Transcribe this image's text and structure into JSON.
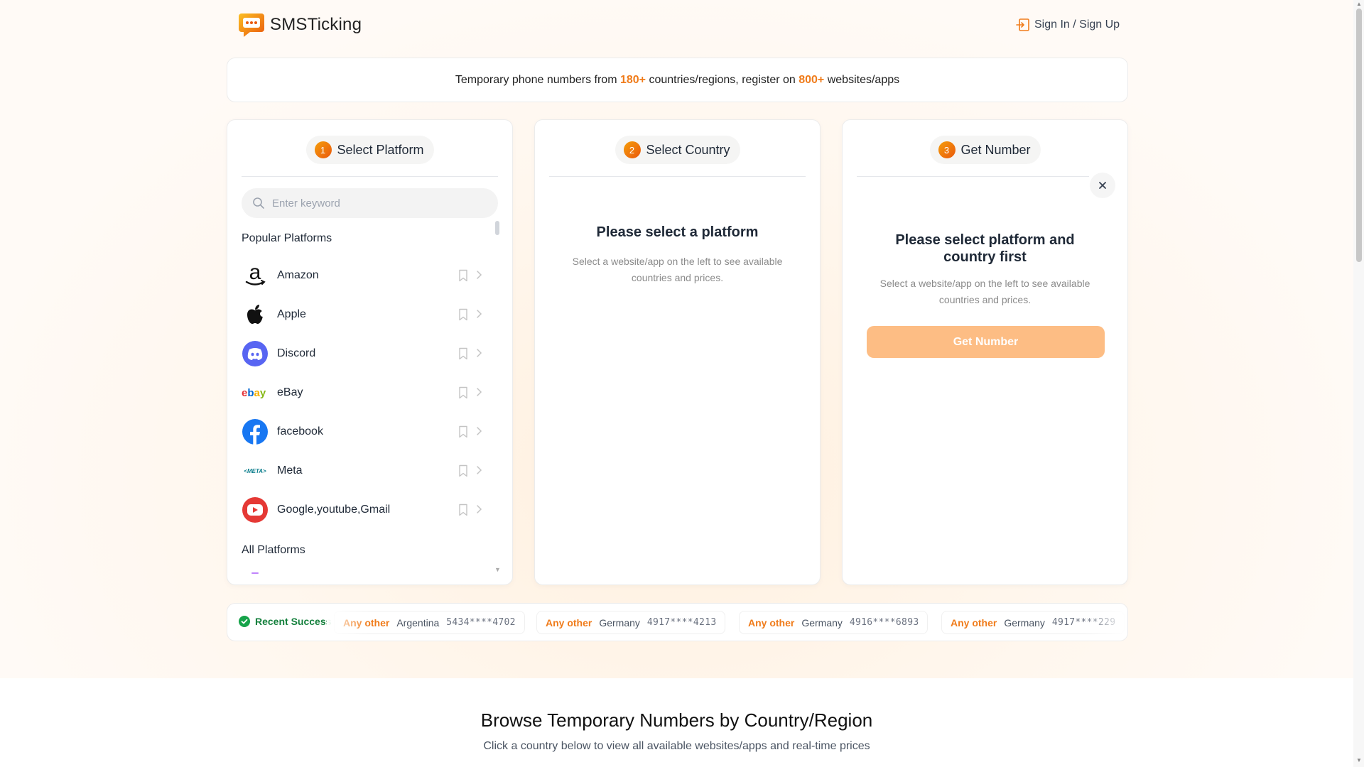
{
  "header": {
    "logo_text": "SMSTicking",
    "signin_label": "Sign In / Sign Up"
  },
  "banner": {
    "part1": "Temporary phone numbers from ",
    "countries_count": "180+",
    "part2": " countries/regions, register on ",
    "sites_count": "800+",
    "part3": " websites/apps"
  },
  "steps": {
    "platform": {
      "num": "1",
      "label": "Select Platform"
    },
    "country": {
      "num": "2",
      "label": "Select Country"
    },
    "number": {
      "num": "3",
      "label": "Get Number"
    }
  },
  "platform_panel": {
    "search_placeholder": "Enter keyword",
    "popular_title": "Popular Platforms",
    "all_title": "All Platforms",
    "popular": [
      {
        "label": "Amazon",
        "icon": "amazon-icon"
      },
      {
        "label": "Apple",
        "icon": "apple-icon"
      },
      {
        "label": "Discord",
        "icon": "discord-icon"
      },
      {
        "label": "eBay",
        "icon": "ebay-icon"
      },
      {
        "label": "facebook",
        "icon": "facebook-icon"
      },
      {
        "label": "Meta",
        "icon": "meta-icon"
      },
      {
        "label": "Google,youtube,Gmail",
        "icon": "youtube-icon"
      }
    ]
  },
  "country_panel": {
    "empty_title": "Please select a platform",
    "empty_desc": "Select a website/app on the left to see available countries and prices."
  },
  "number_panel": {
    "empty_title": "Please select platform and country first",
    "empty_desc": "Select a website/app on the left to see available countries and prices.",
    "button_label": "Get Number"
  },
  "recent": {
    "label": "Recent Success",
    "items": [
      {
        "platform": "Any other",
        "country": "Argentina",
        "number": "5434****4702"
      },
      {
        "platform": "Any other",
        "country": "Germany",
        "number": "4917****4213"
      },
      {
        "platform": "Any other",
        "country": "Germany",
        "number": "4916****6893"
      },
      {
        "platform": "Any other",
        "country": "Germany",
        "number": "4917****229"
      }
    ]
  },
  "browse": {
    "title": "Browse Temporary Numbers by Country/Region",
    "subtitle": "Click a country below to view all available websites/apps and real-time prices"
  },
  "colors": {
    "accent": "#f07c1b",
    "success": "#15803d",
    "button_disabled": "#fdbd84"
  }
}
